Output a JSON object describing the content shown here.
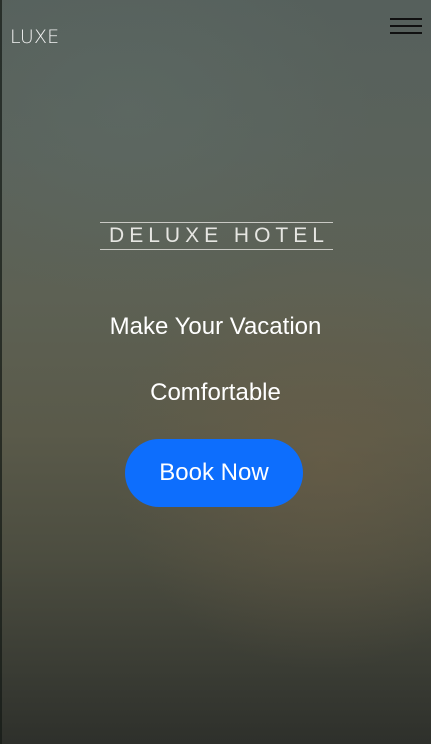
{
  "navbar": {
    "brand": "LUXE",
    "menu_icon": "hamburger-menu-icon"
  },
  "hero": {
    "subtitle": "DELUXE HOTEL",
    "headline_line1": "Make Your Vacation",
    "headline_line2": "Comfortable",
    "cta_label": "Book Now"
  },
  "colors": {
    "cta_background": "#0d6efd",
    "cta_text": "#ffffff",
    "headline_text": "#ffffff",
    "menu_icon": "#111111"
  }
}
